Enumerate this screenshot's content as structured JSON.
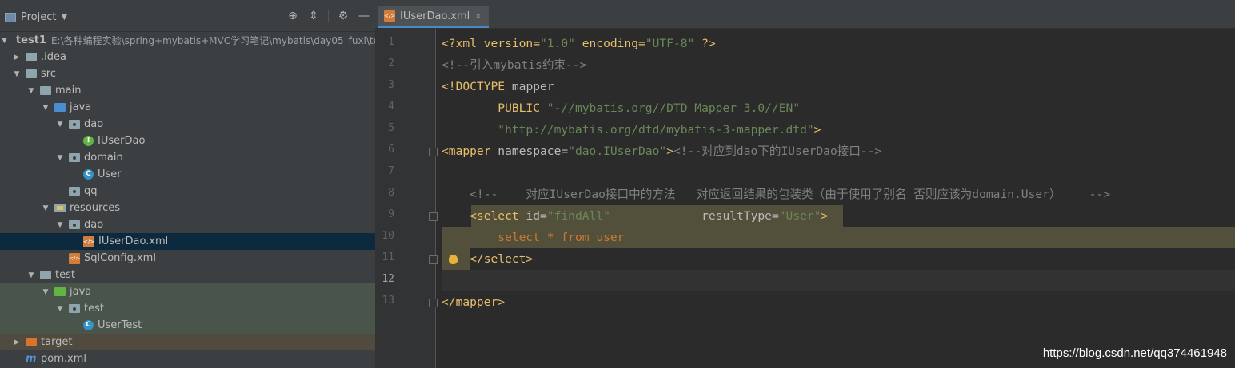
{
  "sidebar": {
    "title": "Project",
    "tree": [
      {
        "label": "test1",
        "path": "E:\\各种编程实验\\spring+mybatis+MVC学习笔记\\mybatis\\day05_fuxi\\te",
        "icon": "module-icon",
        "arrow": "expanded"
      },
      {
        "label": ".idea",
        "icon": "folder-icon",
        "arrow": "collapsed"
      },
      {
        "label": "src",
        "icon": "folder-icon",
        "arrow": "expanded"
      },
      {
        "label": "main",
        "icon": "folder-icon",
        "arrow": "expanded"
      },
      {
        "label": "java",
        "icon": "source-folder-icon",
        "arrow": "expanded"
      },
      {
        "label": "dao",
        "icon": "package-icon",
        "arrow": "expanded"
      },
      {
        "label": "IUserDao",
        "icon": "interface-icon",
        "arrow": "none"
      },
      {
        "label": "domain",
        "icon": "package-icon",
        "arrow": "expanded"
      },
      {
        "label": "User",
        "icon": "class-icon",
        "arrow": "none"
      },
      {
        "label": "qq",
        "icon": "package-icon",
        "arrow": "none"
      },
      {
        "label": "resources",
        "icon": "resources-folder-icon",
        "arrow": "expanded"
      },
      {
        "label": "dao",
        "icon": "package-icon",
        "arrow": "expanded"
      },
      {
        "label": "IUserDao.xml",
        "icon": "xml-file-icon",
        "arrow": "none"
      },
      {
        "label": "SqlConfig.xml",
        "icon": "xml-file-icon",
        "arrow": "none"
      },
      {
        "label": "test",
        "icon": "folder-icon",
        "arrow": "expanded"
      },
      {
        "label": "java",
        "icon": "test-folder-icon",
        "arrow": "expanded"
      },
      {
        "label": "test",
        "icon": "package-icon",
        "arrow": "expanded"
      },
      {
        "label": "UserTest",
        "icon": "test-class-icon",
        "arrow": "none"
      },
      {
        "label": "target",
        "icon": "excluded-folder-icon",
        "arrow": "collapsed"
      },
      {
        "label": "pom.xml",
        "icon": "maven-icon",
        "arrow": "none"
      }
    ]
  },
  "editor": {
    "tab_label": "IUserDao.xml",
    "line_numbers": [
      "1",
      "2",
      "3",
      "4",
      "5",
      "6",
      "7",
      "8",
      "9",
      "10",
      "11",
      "12",
      "13"
    ],
    "code": {
      "l1_a": "<?xml version=",
      "l1_b": "\"1.0\"",
      "l1_c": " encoding=",
      "l1_d": "\"UTF-8\"",
      "l1_e": " ?>",
      "l2": "<!--引入mybatis约束-->",
      "l3_a": "<!DOCTYPE ",
      "l3_b": "mapper",
      "l4_a": "        PUBLIC ",
      "l4_b": "\"-//mybatis.org//DTD Mapper 3.0//EN\"",
      "l5": "        \"http://mybatis.org/dtd/mybatis-3-mapper.dtd\"",
      "l5_end": ">",
      "l6_a": "<mapper ",
      "l6_b": "namespace=",
      "l6_c": "\"dao.IUserDao\"",
      "l6_d": ">",
      "l6_e": "<!--对应到dao下的IUserDao接口-->",
      "l8": "    <!--    对应IUserDao接口中的方法   对应返回结果的包装类（由于使用了别名 否则应该为domain.User）    -->",
      "l9_a": "    <select ",
      "l9_b": "id=",
      "l9_c": "\"findAll\"",
      "l9_d": "             resultType=",
      "l9_e": "\"User\"",
      "l9_f": ">",
      "l10_a": "        select * ",
      "l10_b": "from ",
      "l10_c": "user",
      "l11": "    </select>",
      "l13": "</mapper>"
    }
  },
  "watermark": "https://blog.csdn.net/qq374461948"
}
